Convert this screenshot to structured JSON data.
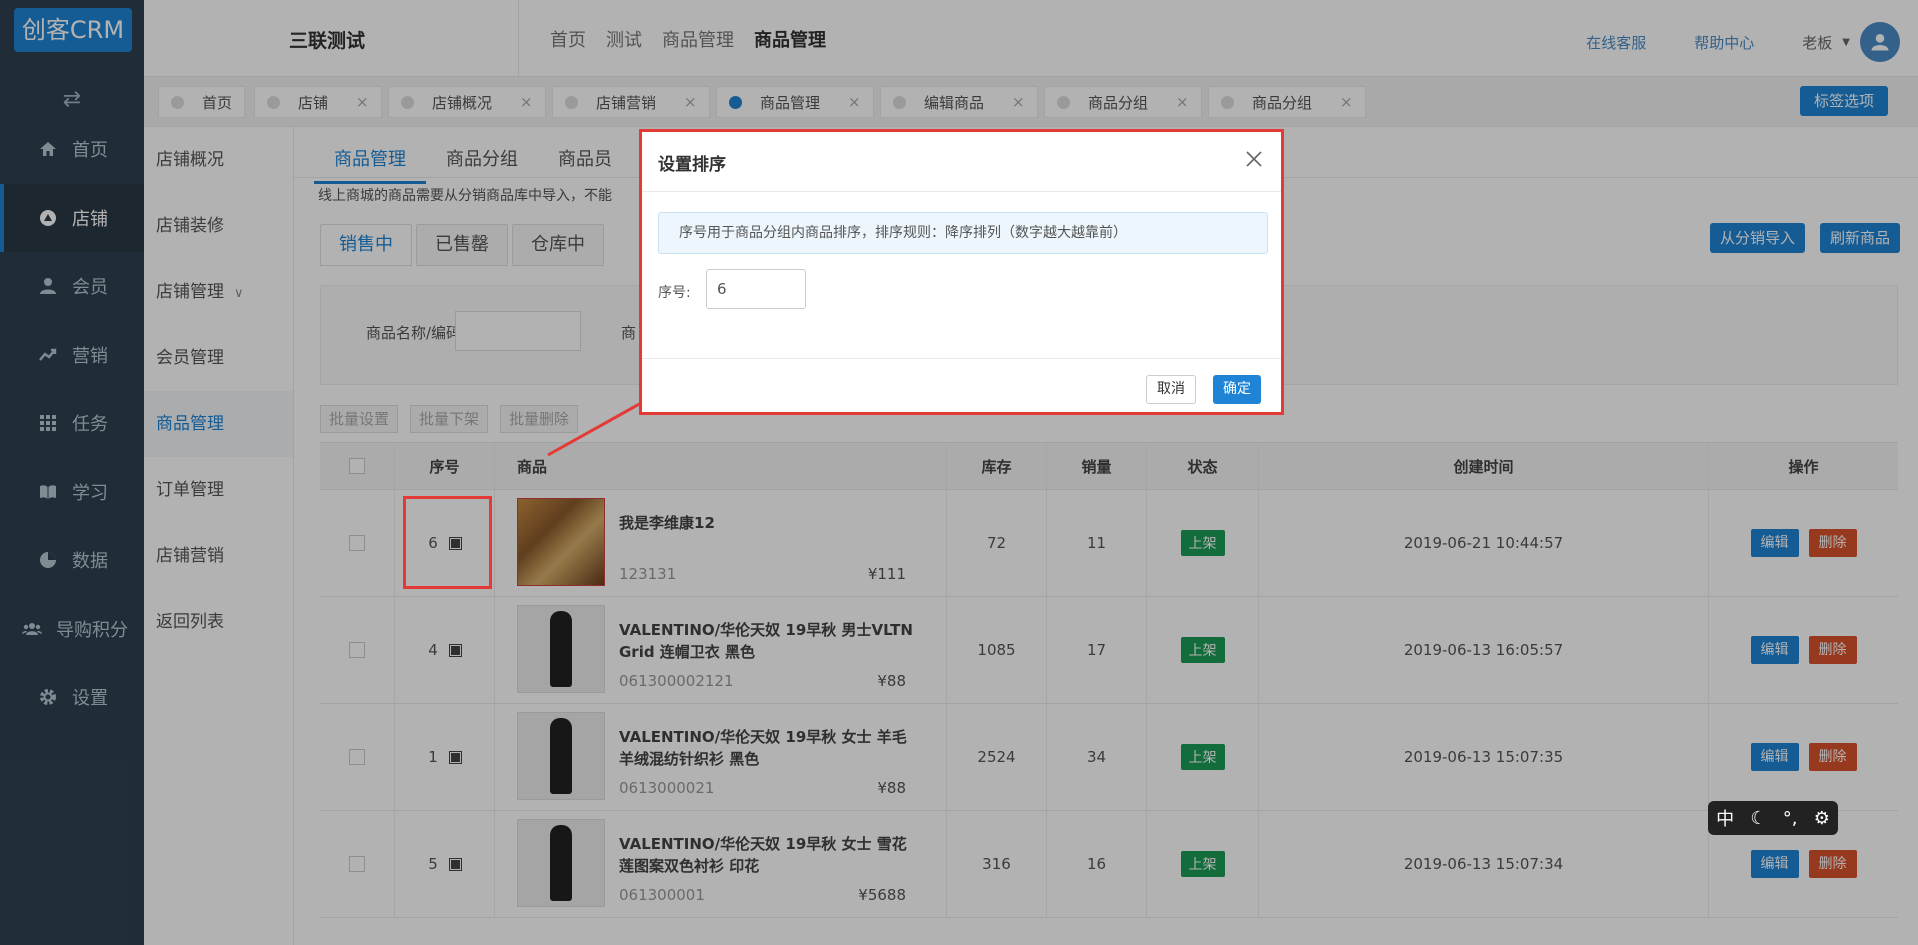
{
  "app": {
    "logo": "创客CRM",
    "store_name": "三联测试"
  },
  "sidebar": {
    "items": [
      {
        "label": "首页",
        "icon": "home-icon"
      },
      {
        "label": "店铺",
        "icon": "store-icon"
      },
      {
        "label": "会员",
        "icon": "user-icon"
      },
      {
        "label": "营销",
        "icon": "trend-icon"
      },
      {
        "label": "任务",
        "icon": "grid-icon"
      },
      {
        "label": "学习",
        "icon": "book-icon"
      },
      {
        "label": "数据",
        "icon": "pie-icon"
      },
      {
        "label": "导购积分",
        "icon": "group-icon"
      },
      {
        "label": "设置",
        "icon": "gear-icon"
      }
    ]
  },
  "topnav": {
    "items": [
      "首页",
      "测试",
      "商品管理",
      "商品管理"
    ]
  },
  "topright": {
    "service": "在线客服",
    "help": "帮助中心",
    "user": "老板"
  },
  "tabs": {
    "items": [
      "首页",
      "店铺",
      "店铺概况",
      "店铺营销",
      "商品管理",
      "编辑商品",
      "商品分组",
      "商品分组"
    ],
    "options": "标签选项"
  },
  "submenu": {
    "items": [
      "店铺概况",
      "店铺装修",
      "店铺管理",
      "会员管理",
      "商品管理",
      "订单管理",
      "店铺营销",
      "返回列表"
    ]
  },
  "main": {
    "tabs": [
      "商品管理",
      "商品分组",
      "商品员"
    ],
    "notice": "线上商城的商品需要从分销商品库中导入，不能",
    "ptabs": [
      "销售中",
      "已售罄",
      "仓库中"
    ],
    "import_btn": "从分销导入",
    "refresh_btn": "刷新商品",
    "search_label": "商品名称/编码",
    "search_label2": "商",
    "batch": [
      "批量设置",
      "批量下架",
      "批量删除"
    ]
  },
  "table": {
    "headers": [
      "序号",
      "商品",
      "库存",
      "销量",
      "状态",
      "创建时间",
      "操作"
    ],
    "rows": [
      {
        "seq": "6",
        "name": "我是李维康12",
        "code": "123131",
        "price": "¥111",
        "stock": "72",
        "sales": "11",
        "status": "上架",
        "time": "2019-06-21 10:44:57"
      },
      {
        "seq": "4",
        "name": "VALENTINO/华伦天奴 19早秋 男士VLTN Grid 连帽卫衣 黑色",
        "code": "061300002121",
        "price": "¥88",
        "stock": "1085",
        "sales": "17",
        "status": "上架",
        "time": "2019-06-13 16:05:57"
      },
      {
        "seq": "1",
        "name": "VALENTINO/华伦天奴 19早秋 女士 羊毛羊绒混纺针织衫 黑色",
        "code": "0613000021",
        "price": "¥88",
        "stock": "2524",
        "sales": "34",
        "status": "上架",
        "time": "2019-06-13 15:07:35"
      },
      {
        "seq": "5",
        "name": "VALENTINO/华伦天奴 19早秋 女士 雪花莲图案双色衬衫 印花",
        "code": "061300001",
        "price": "¥5688",
        "stock": "316",
        "sales": "16",
        "status": "上架",
        "time": "2019-06-13 15:07:34"
      }
    ],
    "edit": "编辑",
    "delete": "删除"
  },
  "dialog": {
    "title": "设置排序",
    "tip": "序号用于商品分组内商品排序，排序规则：降序排列（数字越大越靠前）",
    "label": "序号:",
    "value": "6",
    "cancel": "取消",
    "ok": "确定"
  },
  "ime": {
    "lang": "中"
  }
}
